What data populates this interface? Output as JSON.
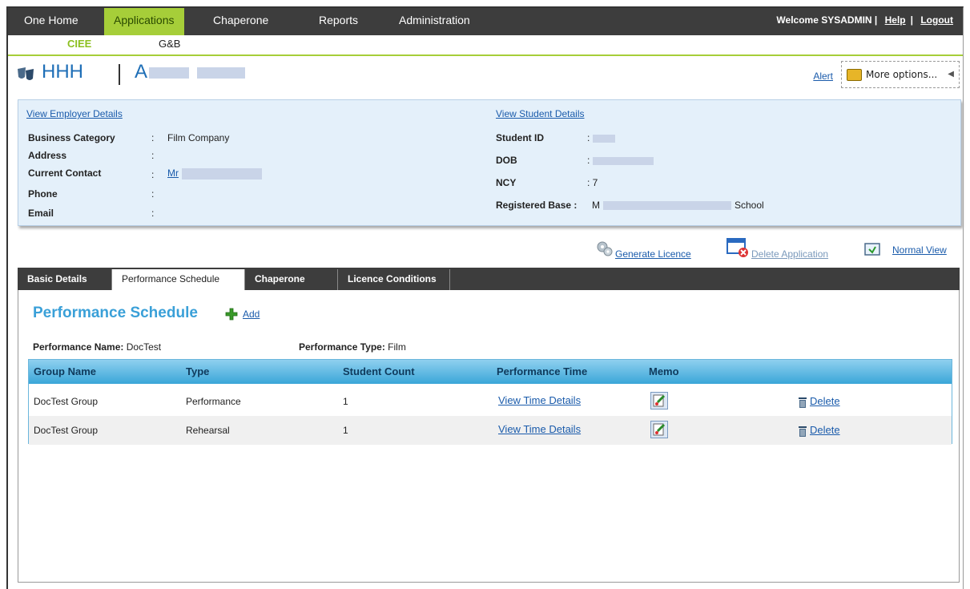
{
  "nav": {
    "items": [
      "One Home",
      "Applications",
      "Chaperone",
      "Reports",
      "Administration"
    ],
    "active": "Applications",
    "welcome": "Welcome",
    "user": "SYSADMIN",
    "help": "Help",
    "logout": "Logout"
  },
  "subnav": {
    "items": [
      "CIEE",
      "G&B"
    ],
    "active": "CIEE"
  },
  "header": {
    "title": "HHH",
    "name_initial": "A",
    "alert": "Alert",
    "more_options": "More options..."
  },
  "employer": {
    "link": "View Employer Details",
    "business_category_label": "Business Category",
    "business_category": "Film Company",
    "address_label": "Address",
    "contact_label": "Current Contact",
    "contact_prefix": "Mr",
    "phone_label": "Phone",
    "email_label": "Email"
  },
  "student": {
    "link": "View Student Details",
    "id_label": "Student ID",
    "dob_label": "DOB",
    "ncy_label": "NCY",
    "ncy": ": 7",
    "base_label": "Registered Base :",
    "base_prefix": "M",
    "base_suffix": "School"
  },
  "actions": {
    "generate": "Generate Licence",
    "delete_app": "Delete Application",
    "normal_view": "Normal View"
  },
  "tabs": [
    "Basic Details",
    "Performance Schedule",
    "Chaperone",
    "Licence Conditions"
  ],
  "active_tab": "Performance Schedule",
  "schedule": {
    "title": "Performance Schedule",
    "add": "Add",
    "perf_name_label": "Performance Name:",
    "perf_name": "DocTest",
    "perf_type_label": "Performance Type:",
    "perf_type": "Film",
    "columns": [
      "Group Name",
      "Type",
      "Student Count",
      "Performance Time",
      "Memo"
    ],
    "rows": [
      {
        "group": "DocTest Group",
        "type": "Performance",
        "count": "1",
        "time": "View Time Details",
        "delete": "Delete"
      },
      {
        "group": "DocTest Group",
        "type": "Rehearsal",
        "count": "1",
        "time": "View Time Details",
        "delete": "Delete"
      }
    ]
  },
  "colors": {
    "nav_bg": "#3d3d3d",
    "accent_green": "#a6ce39",
    "link_blue": "#1a5bab",
    "grid_header": "#3aa6d8",
    "panel_bg": "#e4f0fa"
  }
}
